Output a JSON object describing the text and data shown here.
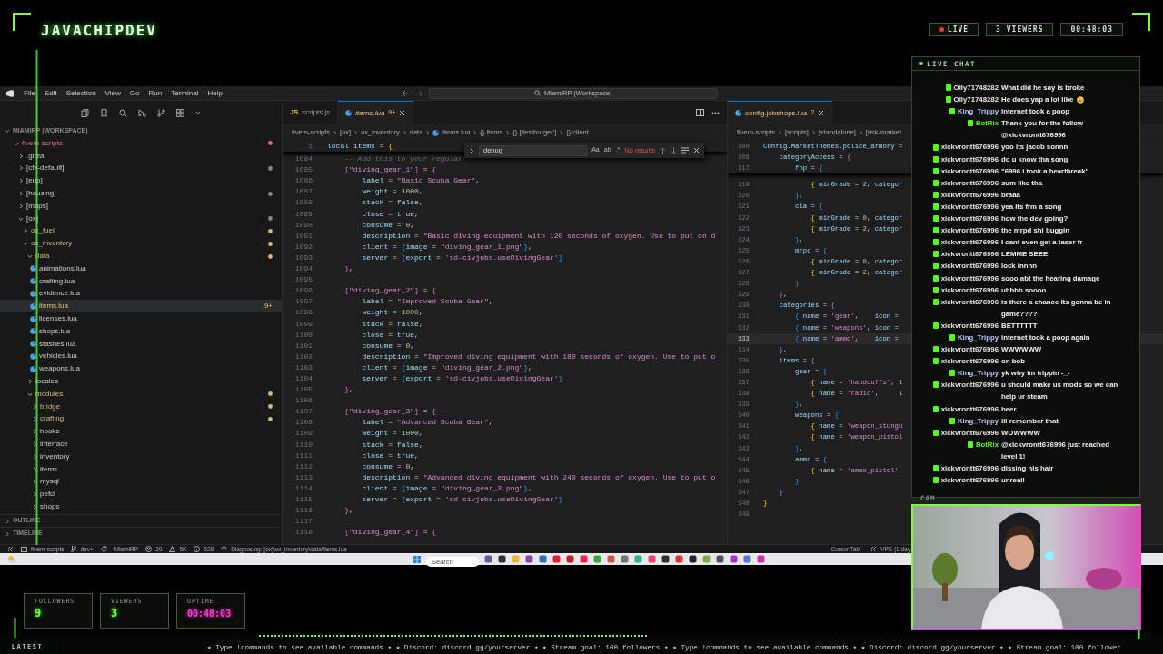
{
  "overlay": {
    "logo": "JAVACHIPDEV",
    "badges": [
      {
        "kind": "live",
        "text": "LIVE"
      },
      {
        "kind": "viewers",
        "text": "3 VIEWERS"
      },
      {
        "kind": "uptime",
        "text": "00:48:03"
      }
    ]
  },
  "window": {
    "menu": [
      "File",
      "Edit",
      "Selection",
      "View",
      "Go",
      "Run",
      "Terminal",
      "Help"
    ],
    "command_center": "MiamiRP (Workspace)"
  },
  "sidebar": {
    "section": "MIAMIRP (WORKSPACE)",
    "tree": [
      {
        "label": "fivem-scripts",
        "kind": "folder",
        "expanded": true,
        "color": "#e06c8a",
        "dot": true,
        "selected": false,
        "children": [
          {
            "label": ".gitea",
            "kind": "folder",
            "expanded": false,
            "selected": false
          },
          {
            "label": "[cfx-default]",
            "kind": "folder",
            "expanded": false,
            "dot": true,
            "selected": false
          },
          {
            "label": "[eup]",
            "kind": "folder",
            "expanded": false,
            "selected": false
          },
          {
            "label": "[housing]",
            "kind": "folder",
            "expanded": false,
            "dot": true,
            "selected": false
          },
          {
            "label": "[maps]",
            "kind": "folder",
            "expanded": false,
            "selected": false
          },
          {
            "label": "[ox]",
            "kind": "folder",
            "expanded": true,
            "dot": true,
            "selected": false,
            "children": [
              {
                "label": "ox_fuel",
                "kind": "folder",
                "expanded": false,
                "color": "#d7ba7d",
                "dot": true,
                "selected": false
              },
              {
                "label": "ox_inventory",
                "kind": "folder",
                "expanded": true,
                "color": "#d7ba7d",
                "dot": true,
                "selected": false,
                "children": [
                  {
                    "label": "data",
                    "kind": "folder",
                    "expanded": true,
                    "color": "#d7ba7d",
                    "dot": true,
                    "selected": false,
                    "children": [
                      {
                        "label": "animations.lua",
                        "kind": "file",
                        "selected": false
                      },
                      {
                        "label": "crafting.lua",
                        "kind": "file",
                        "selected": false
                      },
                      {
                        "label": "evidence.lua",
                        "kind": "file",
                        "selected": false
                      },
                      {
                        "label": "items.lua",
                        "kind": "file",
                        "badge": "9+",
                        "selected": true
                      },
                      {
                        "label": "licenses.lua",
                        "kind": "file",
                        "selected": false
                      },
                      {
                        "label": "shops.lua",
                        "kind": "file",
                        "selected": false
                      },
                      {
                        "label": "stashes.lua",
                        "kind": "file",
                        "selected": false
                      },
                      {
                        "label": "vehicles.lua",
                        "kind": "file",
                        "selected": false
                      },
                      {
                        "label": "weapons.lua",
                        "kind": "file",
                        "selected": false
                      }
                    ]
                  },
                  {
                    "label": "locales",
                    "kind": "folder",
                    "expanded": false,
                    "selected": false
                  },
                  {
                    "label": "modules",
                    "kind": "folder",
                    "expanded": true,
                    "color": "#d7ba7d",
                    "dot": true,
                    "selected": false,
                    "children": [
                      {
                        "label": "bridge",
                        "kind": "folder",
                        "expanded": false,
                        "color": "#d7ba7d",
                        "dot": true,
                        "selected": false
                      },
                      {
                        "label": "crafting",
                        "kind": "folder",
                        "expanded": false,
                        "color": "#d7ba7d",
                        "dot": true,
                        "selected": false
                      },
                      {
                        "label": "hooks",
                        "kind": "folder",
                        "expanded": false,
                        "selected": false
                      },
                      {
                        "label": "interface",
                        "kind": "folder",
                        "expanded": false,
                        "selected": false
                      },
                      {
                        "label": "inventory",
                        "kind": "folder",
                        "expanded": false,
                        "selected": false
                      },
                      {
                        "label": "items",
                        "kind": "folder",
                        "expanded": false,
                        "selected": false
                      },
                      {
                        "label": "mysql",
                        "kind": "folder",
                        "expanded": false,
                        "selected": false
                      },
                      {
                        "label": "pefcl",
                        "kind": "folder",
                        "expanded": false,
                        "selected": false
                      },
                      {
                        "label": "shops",
                        "kind": "folder",
                        "expanded": false,
                        "selected": false
                      }
                    ]
                  }
                ]
              }
            ]
          }
        ]
      }
    ],
    "footer": [
      "OUTLINE",
      "TIMELINE"
    ]
  },
  "editors": [
    {
      "tabs": [
        {
          "label": "scripts.js",
          "icon": "JS",
          "selected": false,
          "preview": false
        },
        {
          "label": "items.lua",
          "badge": "9+",
          "selected": true,
          "preview": true,
          "closable": true
        }
      ],
      "breadcrumb": [
        {
          "text": "fivem-scripts",
          "kind": "folder"
        },
        {
          "text": "[ox]",
          "kind": "folder"
        },
        {
          "text": "ox_inventory",
          "kind": "folder"
        },
        {
          "text": "data",
          "kind": "folder"
        },
        {
          "text": "items.lua",
          "kind": "file"
        },
        {
          "text": "{} items",
          "kind": "symbol"
        },
        {
          "text": "{} ['testburger']",
          "kind": "symbol"
        },
        {
          "text": "{} client",
          "kind": "symbol"
        }
      ],
      "find": {
        "value": "debug",
        "options": [
          "Aa",
          "ab",
          ".*"
        ],
        "result": "No results"
      },
      "sticky": [
        {
          "n": "1",
          "text": "local items = {"
        }
      ],
      "lines": [
        {
          "n": "1084",
          "text": "    -- Add this to your regular"
        },
        {
          "n": "1085",
          "text": "    [\"diving_gear_1\"] = {"
        },
        {
          "n": "1086",
          "text": "        label = \"Basic Scuba Gear\","
        },
        {
          "n": "1087",
          "text": "        weight = 1000,"
        },
        {
          "n": "1088",
          "text": "        stack = false,"
        },
        {
          "n": "1089",
          "text": "        close = true,"
        },
        {
          "n": "1090",
          "text": "        consume = 0,"
        },
        {
          "n": "1091",
          "text": "        description = \"Basic diving equipment with 120 seconds of oxygen. Use to put on d"
        },
        {
          "n": "1092",
          "text": "        client = {image = \"diving_gear_1.png\"},"
        },
        {
          "n": "1093",
          "text": "        server = {export = 'sd-civjobs.useDivingGear'}"
        },
        {
          "n": "1094",
          "text": "    },"
        },
        {
          "n": "1095"
        },
        {
          "n": "1096",
          "text": "    [\"diving_gear_2\"] = {"
        },
        {
          "n": "1097",
          "text": "        label = \"Improved Scuba Gear\","
        },
        {
          "n": "1098",
          "text": "        weight = 1000,"
        },
        {
          "n": "1099",
          "text": "        stack = false,"
        },
        {
          "n": "1100",
          "text": "        close = true,"
        },
        {
          "n": "1101",
          "text": "        consume = 0,"
        },
        {
          "n": "1102",
          "text": "        description = \"Improved diving equipment with 180 seconds of oxygen. Use to put o"
        },
        {
          "n": "1103",
          "text": "        client = {image = \"diving_gear_2.png\"},"
        },
        {
          "n": "1104",
          "text": "        server = {export = 'sd-civjobs.useDivingGear'}"
        },
        {
          "n": "1105",
          "text": "    },"
        },
        {
          "n": "1106"
        },
        {
          "n": "1107",
          "text": "    [\"diving_gear_3\"] = {"
        },
        {
          "n": "1108",
          "text": "        label = \"Advanced Scuba Gear\","
        },
        {
          "n": "1109",
          "text": "        weight = 1000,"
        },
        {
          "n": "1110",
          "text": "        stack = false,"
        },
        {
          "n": "1111",
          "text": "        close = true,"
        },
        {
          "n": "1112",
          "text": "        consume = 0,"
        },
        {
          "n": "1113",
          "text": "        description = \"Advanced diving equipment with 240 seconds of oxygen. Use to put o"
        },
        {
          "n": "1114",
          "text": "        client = {image = \"diving_gear_3.png\"},"
        },
        {
          "n": "1115",
          "text": "        server = {export = 'sd-civjobs.useDivingGear'}"
        },
        {
          "n": "1116",
          "text": "    },"
        },
        {
          "n": "1117"
        },
        {
          "n": "1118",
          "text": "    [\"diving_gear_4\"] = {"
        }
      ]
    },
    {
      "tabs": [
        {
          "label": "config.jobshops.lua",
          "badge": "2",
          "selected": true,
          "preview": false,
          "closable": true
        }
      ],
      "breadcrumb": [
        {
          "text": "fivem-scripts",
          "kind": "folder"
        },
        {
          "text": "[scripts]",
          "kind": "folder"
        },
        {
          "text": "[standalone]",
          "kind": "folder"
        },
        {
          "text": "[risk-market",
          "kind": "folder"
        }
      ],
      "sticky": [
        {
          "n": "100",
          "text": "Config.MarketThemes.police_armory ="
        },
        {
          "n": "108",
          "text": "    categoryAccess = {"
        },
        {
          "n": "117",
          "text": "        fhp = {"
        }
      ],
      "lines": [
        {
          "n": "119",
          "text": "            { minGrade = 2, categor"
        },
        {
          "n": "120",
          "text": "        },"
        },
        {
          "n": "121",
          "text": "        cia = {"
        },
        {
          "n": "122",
          "text": "            { minGrade = 0, categor"
        },
        {
          "n": "123",
          "text": "            { minGrade = 2, categor"
        },
        {
          "n": "124",
          "text": "        },"
        },
        {
          "n": "125",
          "text": "        mrpd = {"
        },
        {
          "n": "126",
          "text": "            { minGrade = 0, categor"
        },
        {
          "n": "127",
          "text": "            { minGrade = 2, categor"
        },
        {
          "n": "128",
          "text": "        }"
        },
        {
          "n": "129",
          "text": "    },"
        },
        {
          "n": "130",
          "text": "    categories = {"
        },
        {
          "n": "131",
          "text": "        { name = 'gear',    icon ="
        },
        {
          "n": "132",
          "text": "        { name = 'weapons', icon ="
        },
        {
          "n": "133",
          "text": "        { name = 'ammo',    icon =",
          "current": true
        },
        {
          "n": "134",
          "text": "    },"
        },
        {
          "n": "135",
          "text": "    items = {"
        },
        {
          "n": "136",
          "text": "        gear = {"
        },
        {
          "n": "137",
          "text": "            { name = 'handcuffs', l"
        },
        {
          "n": "138",
          "text": "            { name = 'radio',     l"
        },
        {
          "n": "139",
          "text": "        },"
        },
        {
          "n": "140",
          "text": "        weapons = {"
        },
        {
          "n": "141",
          "text": "            { name = 'weapon_stungu"
        },
        {
          "n": "142",
          "text": "            { name = 'weapon_pistol"
        },
        {
          "n": "143",
          "text": "        },"
        },
        {
          "n": "144",
          "text": "        ammo = {"
        },
        {
          "n": "145",
          "text": "            { name = 'ammo_pistol',"
        },
        {
          "n": "146",
          "text": "        }"
        },
        {
          "n": "147",
          "text": "    }"
        },
        {
          "n": "148",
          "text": "}"
        },
        {
          "n": "149"
        }
      ]
    }
  ],
  "status_bar": {
    "left": [
      {
        "kind": "remote"
      },
      {
        "kind": "folder",
        "text": "fivem-scripts"
      },
      {
        "kind": "branch",
        "text": "dev+"
      },
      {
        "kind": "sync"
      },
      {
        "kind": "plain",
        "text": "MiamiRP"
      },
      {
        "kind": "errors",
        "text": "20"
      },
      {
        "kind": "warnings",
        "text": "5K"
      },
      {
        "kind": "info",
        "text": "528"
      },
      {
        "kind": "progress",
        "text": "Diagnosing: [ox]\\ox_inventory\\data\\items.lua"
      }
    ],
    "right": [
      {
        "kind": "plain",
        "text": "Cursor Tab"
      },
      {
        "kind": "remote",
        "text": "VPS (1 day"
      }
    ]
  },
  "taskbar": {
    "search": {
      "placeholder": "Search"
    }
  },
  "chat": {
    "title": "LIVE CHAT",
    "messages": [
      {
        "user": "Olly71748282",
        "color": "#e6e6e6",
        "text": "What did he say is broke"
      },
      {
        "user": "Olly71748282",
        "color": "#e6e6e6",
        "text": "He does yap a lot like",
        "emoji": true
      },
      {
        "user": "King_Trippy",
        "color": "#b3c9ff",
        "text": "internet took a poop"
      },
      {
        "user": "BotRix",
        "color": "#53fc18",
        "text": "Thank you for the follow @xickvrontt676996"
      },
      {
        "user": "xickvrontt676996",
        "color": "#e6e6e6",
        "text": "yoo its jacob sonnn"
      },
      {
        "user": "xickvrontt676996",
        "color": "#e6e6e6",
        "text": "do u know tha song"
      },
      {
        "user": "xickvrontt676996",
        "color": "#e6e6e6",
        "text": "\"6996 i took a heartbreak\""
      },
      {
        "user": "xickvrontt676996",
        "color": "#e6e6e6",
        "text": "sum like tha"
      },
      {
        "user": "xickvrontt676996",
        "color": "#e6e6e6",
        "text": "braaa"
      },
      {
        "user": "xickvrontt676996",
        "color": "#e6e6e6",
        "text": "yea its frm a song"
      },
      {
        "user": "xickvrontt676996",
        "color": "#e6e6e6",
        "text": "how the dev going?"
      },
      {
        "user": "xickvrontt676996",
        "color": "#e6e6e6",
        "text": "the mrpd shi buggin"
      },
      {
        "user": "xickvrontt676996",
        "color": "#e6e6e6",
        "text": "I cant even get a taser fr"
      },
      {
        "user": "xickvrontt676996",
        "color": "#e6e6e6",
        "text": "LEMME SEEE"
      },
      {
        "user": "xickvrontt676996",
        "color": "#e6e6e6",
        "text": "lock innnn"
      },
      {
        "user": "xickvrontt676996",
        "color": "#e6e6e6",
        "text": "sooo abt the hearing damage"
      },
      {
        "user": "xickvrontt676996",
        "color": "#e6e6e6",
        "text": "uhhhh soooo"
      },
      {
        "user": "xickvrontt676996",
        "color": "#e6e6e6",
        "text": "is there a chance its gonna be in game????"
      },
      {
        "user": "xickvrontt676996",
        "color": "#e6e6e6",
        "text": "BETTTTTT"
      },
      {
        "user": "King_Trippy",
        "color": "#b3c9ff",
        "text": "internet took a poop again"
      },
      {
        "user": "xickvrontt676996",
        "color": "#e6e6e6",
        "text": "WWWWWW"
      },
      {
        "user": "xickvrontt676996",
        "color": "#e6e6e6",
        "text": "on bob"
      },
      {
        "user": "King_Trippy",
        "color": "#b3c9ff",
        "text": "yk why im trippin -_-"
      },
      {
        "user": "xickvrontt676996",
        "color": "#e6e6e6",
        "text": "u should make us mods so we can help ur steam"
      },
      {
        "user": "xickvrontt676996",
        "color": "#e6e6e6",
        "text": "beer"
      },
      {
        "user": "King_Trippy",
        "color": "#b3c9ff",
        "text": "ill remember that"
      },
      {
        "user": "xickvrontt676996",
        "color": "#e6e6e6",
        "text": "WOWWWW"
      },
      {
        "user": "BotRix",
        "color": "#53fc18",
        "text": "@xickvrontt676996 just reached level 1!"
      },
      {
        "user": "xickvrontt676996",
        "color": "#e6e6e6",
        "text": "dissing his hair"
      },
      {
        "user": "xickvrontt676996",
        "color": "#e6e6e6",
        "text": "unreall"
      }
    ]
  },
  "camera": {
    "label": "CAM",
    "kind": "picture"
  },
  "stats": [
    {
      "label": "FOLLOWERS",
      "value": "9",
      "kind": "count"
    },
    {
      "label": "VIEWERS",
      "value": "3",
      "kind": "count"
    },
    {
      "label": "UPTIME",
      "value": "00:48:03",
      "kind": "time"
    }
  ],
  "ticker": {
    "label": "LATEST",
    "text": "★ Type !commands to see available commands ✦ ★ Discord: discord.gg/yourserver ✦ ★ Stream goal: 100 followers ✦ ★ Type !commands to see available commands ✦ ★ Discord: discord.gg/yourserver ✦ ★ Stream goal: 100 follower"
  }
}
